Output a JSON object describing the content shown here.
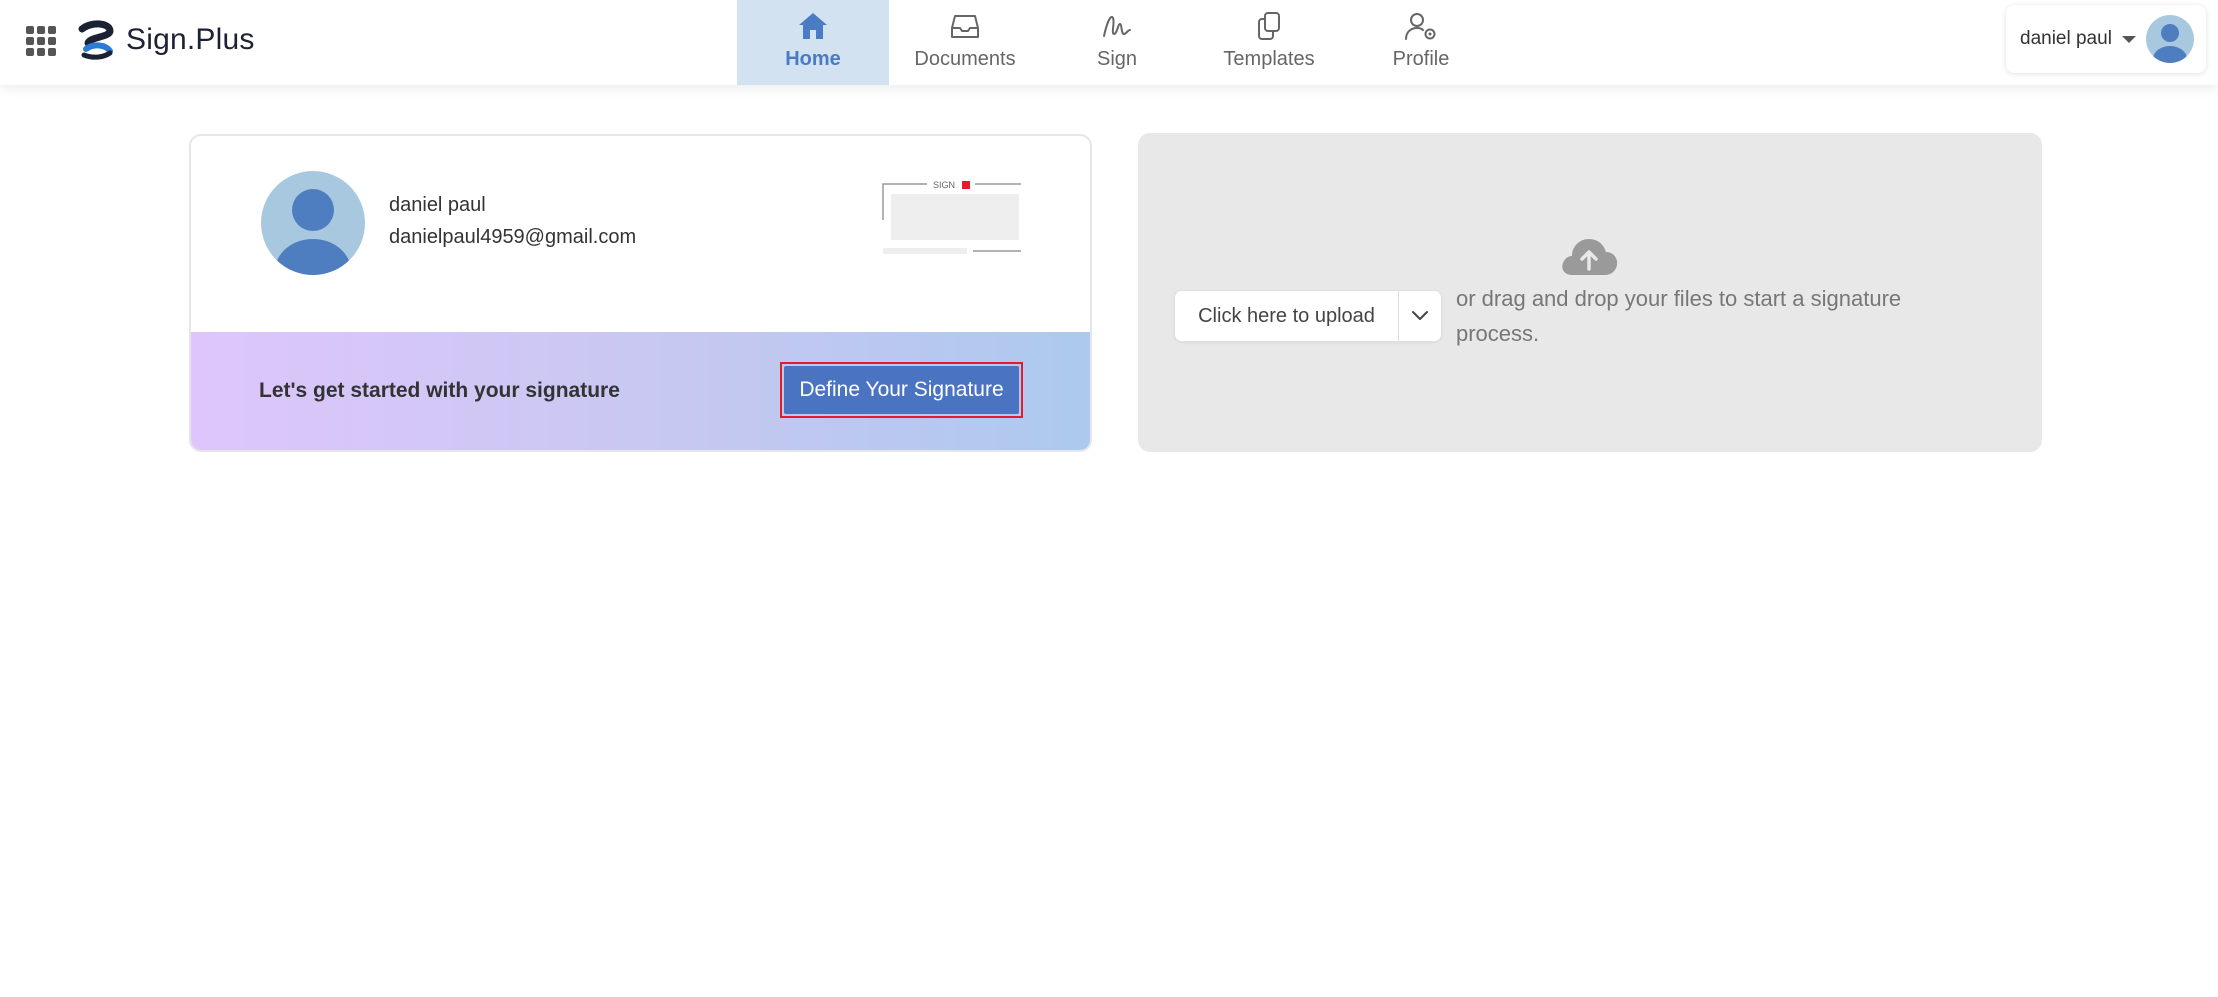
{
  "brand": {
    "name": "Sign.Plus"
  },
  "nav": {
    "items": [
      {
        "label": "Home",
        "icon": "home-icon",
        "active": true
      },
      {
        "label": "Documents",
        "icon": "inbox-icon",
        "active": false
      },
      {
        "label": "Sign",
        "icon": "signature-icon",
        "active": false
      },
      {
        "label": "Templates",
        "icon": "copy-icon",
        "active": false
      },
      {
        "label": "Profile",
        "icon": "user-settings-icon",
        "active": false
      }
    ]
  },
  "user_menu": {
    "name": "daniel paul"
  },
  "profile_card": {
    "name": "daniel paul",
    "email": "danielpaul4959@gmail.com",
    "preview_label": "SIGN",
    "banner_text": "Let's get started with your signature",
    "define_button": "Define Your Signature"
  },
  "upload": {
    "button_label": "Click here to upload",
    "hint": "or drag and drop your files to start a signature process."
  },
  "colors": {
    "accent": "#4a74c2",
    "nav_active_bg": "#d3e2f1",
    "highlight_border": "#e31c2b",
    "upload_bg": "#e8e8e8"
  }
}
